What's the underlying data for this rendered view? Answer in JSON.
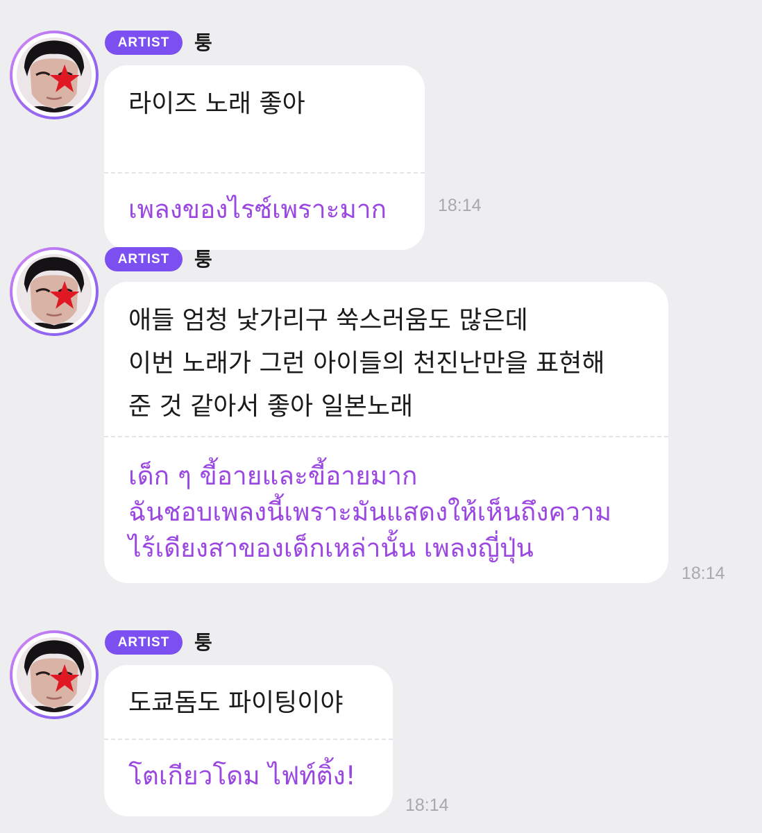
{
  "messages": [
    {
      "badge": "ARTIST",
      "sender": "퉁",
      "korean": [
        "라이즈 노래 좋아"
      ],
      "thai": [
        "เพลงของไรซ์เพราะมาก"
      ],
      "time": "18:14"
    },
    {
      "badge": "ARTIST",
      "sender": "퉁",
      "korean": [
        "애들 엄청 낯가리구 쑥스러움도 많은데",
        "이번 노래가 그런 아이들의 천진난만을 표현해",
        "준 것 같아서 좋아 일본노래"
      ],
      "thai": [
        "เด็ก ๆ ขี้อายและขี้อายมาก",
        "ฉันชอบเพลงนี้เพราะมันแสดงให้เห็นถึงความ",
        "ไร้เดียงสาของเด็กเหล่านั้น เพลงญี่ปุ่น"
      ],
      "time": "18:14"
    },
    {
      "badge": "ARTIST",
      "sender": "퉁",
      "korean": [
        "도쿄돔도 파이팅이야"
      ],
      "thai": [
        "โตเกียวโดม ไฟท์ติ้ง!"
      ],
      "time": "18:14"
    }
  ],
  "colors": {
    "background": "#eeeef0",
    "badge": "#7b4ff0",
    "translation_text": "#9a46e0",
    "timestamp": "#a9a9ad"
  },
  "icons": {
    "avatar": "artist-profile-photo-with-red-star-icon"
  }
}
